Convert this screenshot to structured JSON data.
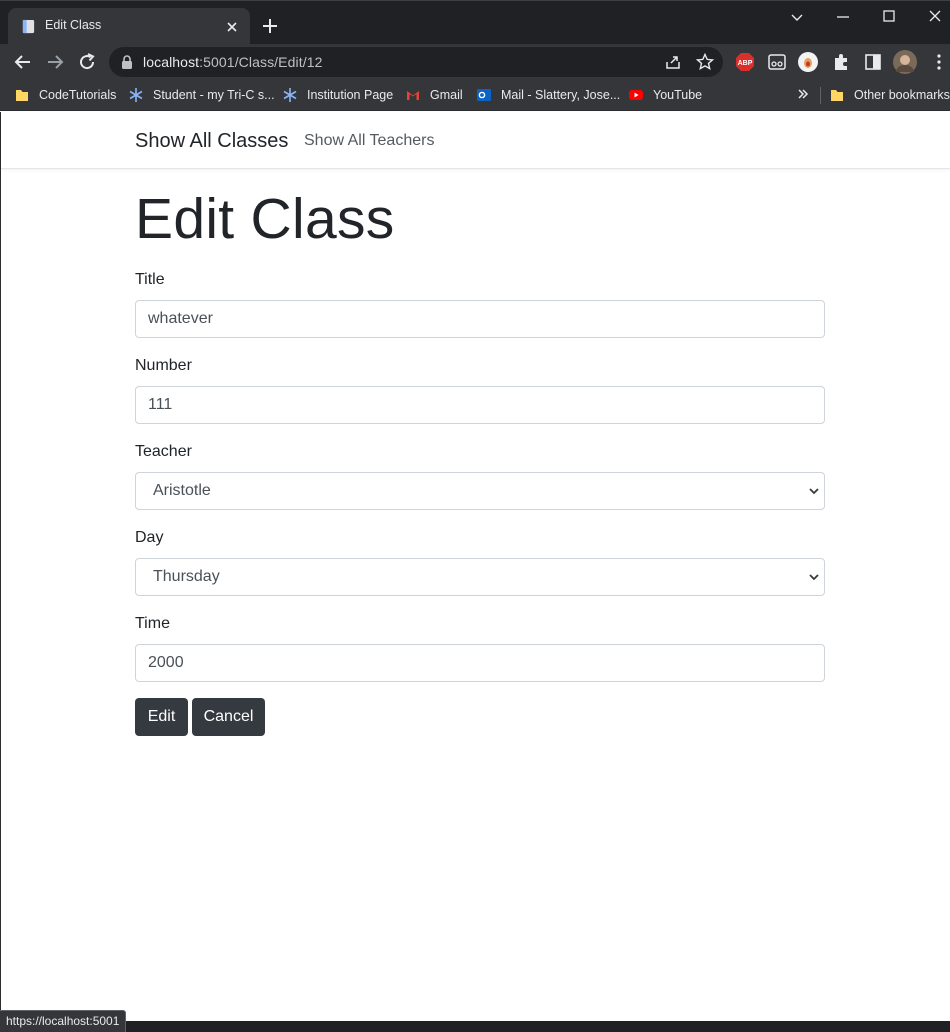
{
  "browser": {
    "tab_title": "Edit Class",
    "url_host": "localhost",
    "url_rest": ":5001/Class/Edit/12",
    "status_url": "https://localhost:5001",
    "bookmarks": [
      {
        "label": "CodeTutorials",
        "icon": "folder-icon"
      },
      {
        "label": "Student - my Tri-C s...",
        "icon": "snowflake-icon"
      },
      {
        "label": "Institution Page",
        "icon": "snowflake-icon"
      },
      {
        "label": "Gmail",
        "icon": "gmail-icon"
      },
      {
        "label": "Mail - Slattery, Jose...",
        "icon": "outlook-icon"
      },
      {
        "label": "YouTube",
        "icon": "youtube-icon"
      }
    ],
    "other_bookmarks": "Other bookmarks",
    "extensions": [
      "abp-icon",
      "reader-icon",
      "profile-ext-icon",
      "puzzle-icon",
      "sidepanel-icon",
      "avatar"
    ],
    "abp_label": "ABP"
  },
  "navbar": {
    "brand": "Show All Classes",
    "link": "Show All Teachers"
  },
  "form": {
    "heading": "Edit Class",
    "title_label": "Title",
    "title_value": "whatever",
    "number_label": "Number",
    "number_value": "111",
    "teacher_label": "Teacher",
    "teacher_value": "Aristotle",
    "day_label": "Day",
    "day_value": "Thursday",
    "time_label": "Time",
    "time_value": "2000",
    "edit_button": "Edit",
    "cancel_button": "Cancel"
  },
  "colors": {
    "button_bg": "#343a40",
    "browser_dark": "#202124",
    "browser_toolbar": "#35363a"
  }
}
